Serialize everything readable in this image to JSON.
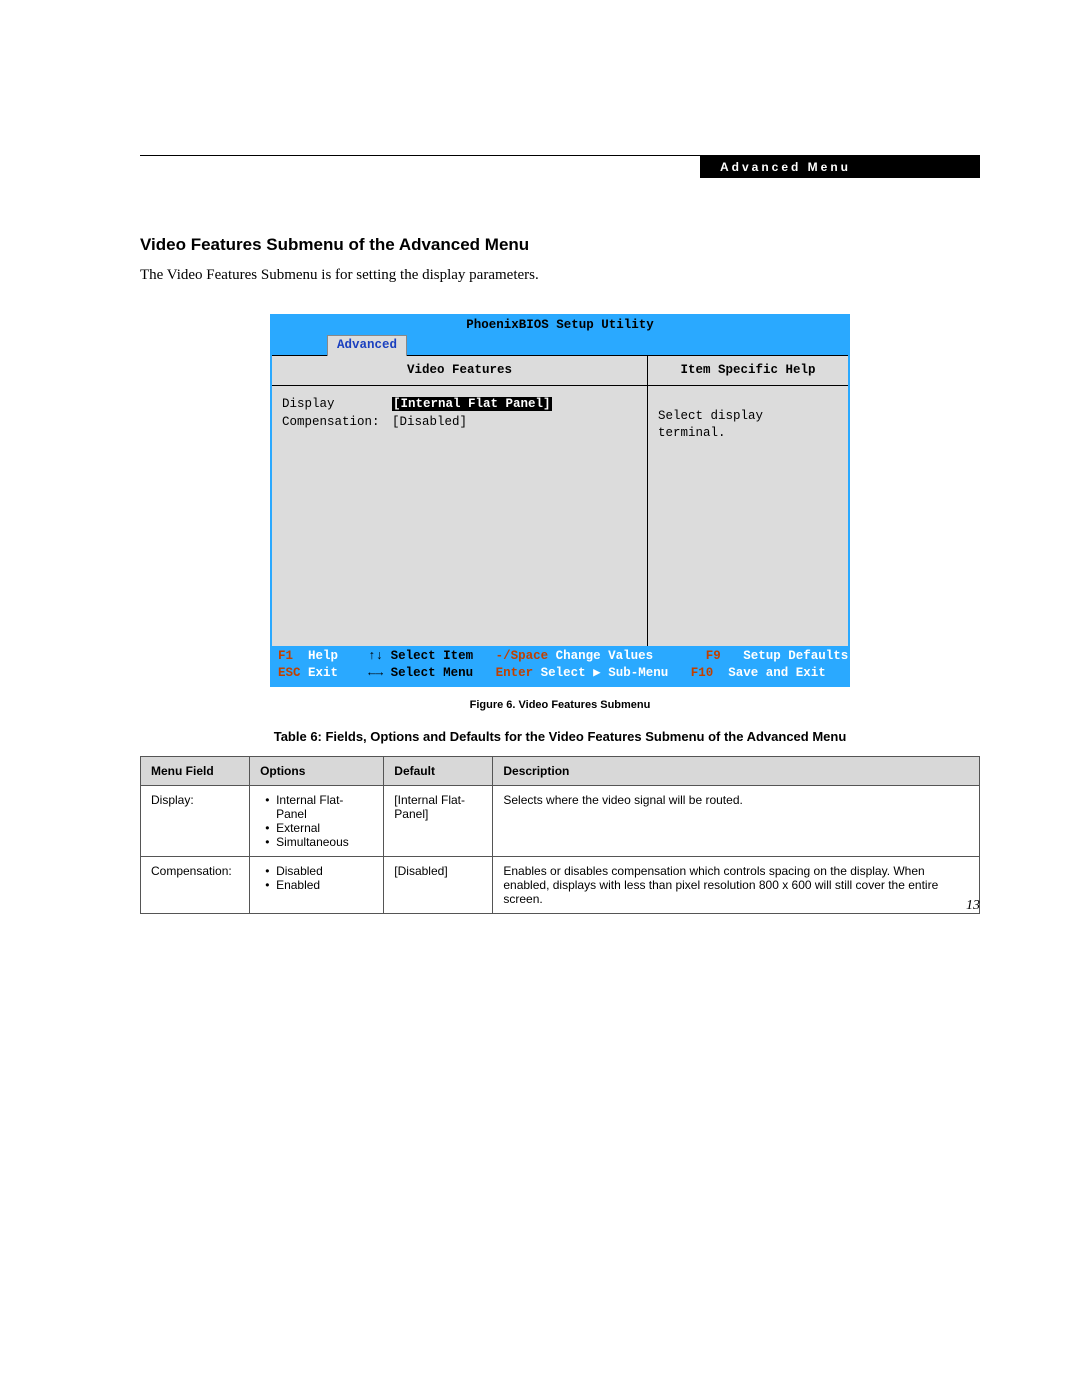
{
  "header": {
    "label": "Advanced Menu"
  },
  "section_title": "Video Features Submenu of the Advanced Menu",
  "intro": "The Video Features Submenu is for setting the display parameters.",
  "bios": {
    "title": "PhoenixBIOS Setup Utility",
    "tab": "Advanced",
    "left_heading": "Video Features",
    "right_heading": "Item Specific Help",
    "right_text": "Select display terminal.",
    "fields": [
      {
        "label": "Display",
        "value": "[Internal Flat Panel]",
        "selected": true
      },
      {
        "label": "Compensation:",
        "value": "[Disabled]",
        "selected": false
      }
    ],
    "footer": {
      "row1": {
        "k1": "F1",
        "l1": "Help",
        "k2": "↑↓",
        "l2": "Select Item",
        "k3": "-/Space",
        "l3": "Change Values",
        "k4": "F9",
        "l4": "Setup Defaults"
      },
      "row2": {
        "k1": "ESC",
        "l1": "Exit",
        "k2": "←→",
        "l2": "Select Menu",
        "k3": "Enter",
        "l3": "Select ▶ Sub-Menu",
        "k4": "F10",
        "l4": "Save and Exit"
      }
    }
  },
  "figcap": "Figure 6.  Video Features Submenu",
  "tablecap": "Table 6: Fields, Options and Defaults for the Video Features Submenu of the Advanced Menu",
  "table": {
    "headers": {
      "c0": "Menu Field",
      "c1": "Options",
      "c2": "Default",
      "c3": "Description"
    },
    "rows": [
      {
        "field": "Display:",
        "options": [
          "Internal Flat-Panel",
          "External",
          "Simultaneous"
        ],
        "default": "[Internal Flat-Panel]",
        "desc": "Selects where the video signal will be routed."
      },
      {
        "field": "Compensation:",
        "options": [
          "Disabled",
          "Enabled"
        ],
        "default": "[Disabled]",
        "desc": "Enables or disables compensation which controls spacing on the display. When enabled, displays with less than pixel resolution 800 x 600 will still cover the entire screen."
      }
    ]
  },
  "page_num": "13"
}
